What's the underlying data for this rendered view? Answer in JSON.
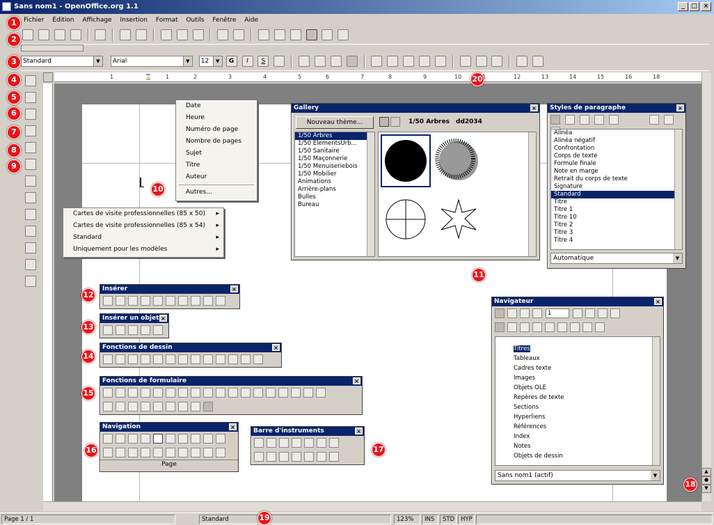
{
  "window": {
    "title": "Sans nom1 - OpenOffice.org 1.1",
    "minimize": "_",
    "maximize": "□",
    "close": "×"
  },
  "menu": [
    "Fichier",
    "Édition",
    "Affichage",
    "Insertion",
    "Format",
    "Outils",
    "Fenêtre",
    "Aide"
  ],
  "format_bar": {
    "style": "Standard",
    "font": "Arial",
    "size": "12",
    "bold": "G",
    "italic": "I",
    "underline": "S"
  },
  "ruler": {
    "marks": [
      "1",
      "1",
      "2",
      "3",
      "4",
      "5",
      "6",
      "7",
      "8",
      "9",
      "10",
      "11",
      "12",
      "13",
      "14",
      "15",
      "16",
      "18"
    ]
  },
  "badges": [
    "1",
    "2",
    "3",
    "4",
    "5",
    "6",
    "7",
    "8",
    "9",
    "10",
    "11",
    "12",
    "13",
    "14",
    "15",
    "16",
    "17",
    "18",
    "19",
    "20"
  ],
  "champs_menu": [
    "Date",
    "Heure",
    "Numéro de page",
    "Nombre de pages",
    "Sujet",
    "Titre",
    "Auteur",
    "Autres..."
  ],
  "modeles_menu": [
    "Cartes de visite professionnelles (85 x 50)",
    "Cartes de visite professionnelles (85 x 54)",
    "Standard",
    "Uniquement pour les modèles"
  ],
  "gallery": {
    "title": "Gallery",
    "new_theme": "Nouveau thème...",
    "current": "1/50 Arbres",
    "file": "dd2034",
    "themes": [
      "1/50 Arbres",
      "1/50 ElementsUrb...",
      "1/50 Sanitaire",
      "1/50 Maçonnerie",
      "1/50 Menuiseriebois",
      "1/50 Mobilier",
      "Animations",
      "Arrière-plans",
      "Bulles",
      "Bureau"
    ]
  },
  "styles": {
    "title": "Styles de paragraphe",
    "items": [
      "Alinéa",
      "Alinéa négatif",
      "Confrontation",
      "Corps de texte",
      "Formule finale",
      "Note en marge",
      "Retrait du corps de texte",
      "Signature",
      "Standard",
      "Titre",
      "Titre 1",
      "Titre 10",
      "Titre 2",
      "Titre 3",
      "Titre 4"
    ],
    "selected": "Standard",
    "filter": "Automatique"
  },
  "insert_bar": {
    "title": "Insérer"
  },
  "insert_object_bar": {
    "title": "Insérer un objet"
  },
  "draw_bar": {
    "title": "Fonctions de dessin"
  },
  "form_bar": {
    "title": "Fonctions de formulaire"
  },
  "nav_bar": {
    "title": "Navigation",
    "footer": "Page"
  },
  "tools_bar": {
    "title": "Barre d'instruments"
  },
  "navigator": {
    "title": "Navigateur",
    "page": "1",
    "items": [
      "Titres",
      "Tableaux",
      "Cadres texte",
      "Images",
      "Objets OLE",
      "Repères de texte",
      "Sections",
      "Hyperliens",
      "Références",
      "Index",
      "Notes",
      "Objets de dessin"
    ],
    "doc": "Sans nom1 (actif)"
  },
  "status": {
    "page": "Page 1 / 1",
    "style": "Standard",
    "zoom": "123%",
    "ins": "INS",
    "std": "STD",
    "hyp": "HYP"
  }
}
